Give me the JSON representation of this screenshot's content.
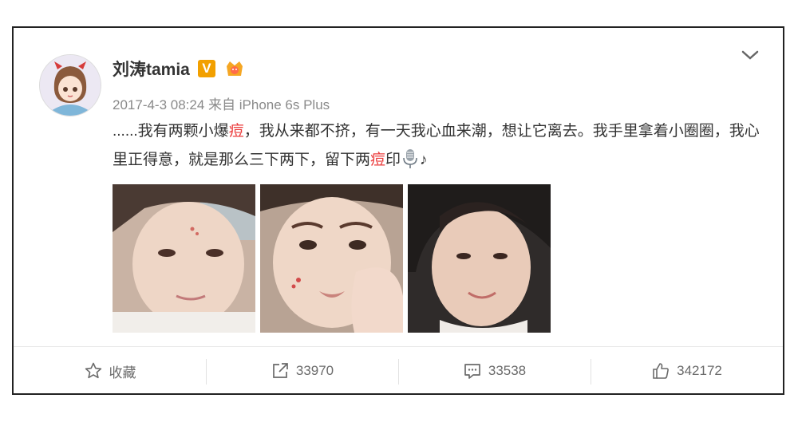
{
  "post": {
    "username": "刘涛tamia",
    "verified_badge": "V",
    "meta": "2017-4-3 08:24 来自 iPhone 6s Plus",
    "text_seg1": "......我有两颗小爆",
    "text_hl1": "痘",
    "text_seg2": "，我从来都不挤，有一天我心血来潮，想让它离去。我手里拿着小圈圈，我心里正得意，就是那么三下两下，留下两",
    "text_hl2": "痘",
    "text_seg3": "印",
    "text_tail": "♪",
    "icons": [
      "avatar",
      "crown-badge-icon",
      "microphone-icon",
      "chevron-down-icon"
    ]
  },
  "actions": [
    {
      "id": "favorite",
      "label": "收藏",
      "icon": "star-icon"
    },
    {
      "id": "repost",
      "label": "33970",
      "icon": "share-icon"
    },
    {
      "id": "comment",
      "label": "33538",
      "icon": "comment-icon"
    },
    {
      "id": "like",
      "label": "342172",
      "icon": "thumbs-up-icon"
    }
  ],
  "colors": {
    "highlight": "#eb3b3b",
    "badge": "#f2a000",
    "meta_text": "#8a8a8a"
  }
}
